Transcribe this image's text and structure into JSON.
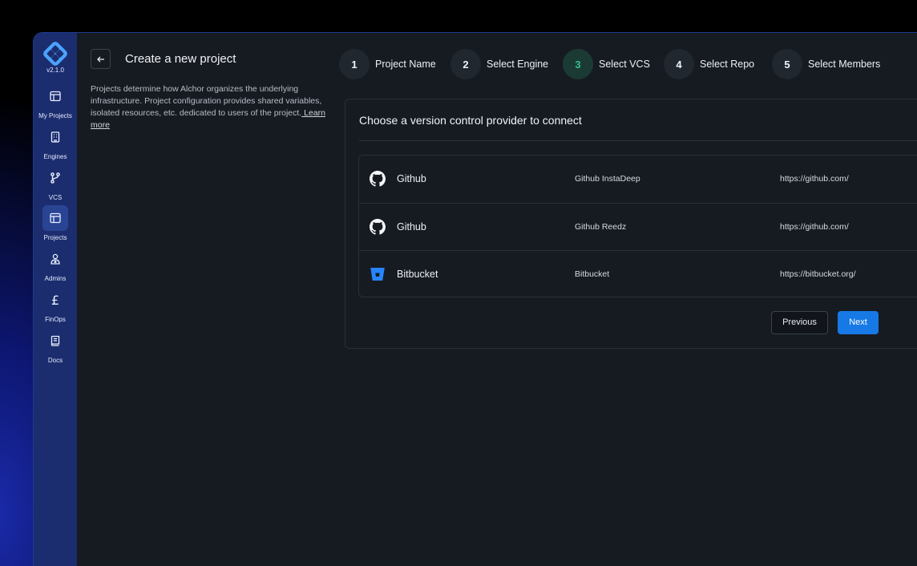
{
  "app": {
    "version": "v2.1.0"
  },
  "sidebar": {
    "items": [
      {
        "label": "My Projects",
        "icon": "layout-icon",
        "active": false
      },
      {
        "label": "Engines",
        "icon": "building-icon",
        "active": false
      },
      {
        "label": "VCS",
        "icon": "git-branch-icon",
        "active": false
      },
      {
        "label": "Projects",
        "icon": "layout-icon",
        "active": true
      },
      {
        "label": "Admins",
        "icon": "admin-user-icon",
        "active": false
      },
      {
        "label": "FinOps",
        "icon": "pound-icon",
        "active": false
      },
      {
        "label": "Docs",
        "icon": "book-icon",
        "active": false
      }
    ]
  },
  "header": {
    "title": "Create a new project",
    "description": "Projects determine how Alchor organizes the underlying infrastructure.  Project configuration provides shared variables, isolated resources,  etc. dedicated to users of the project.",
    "learn_more": " Learn more"
  },
  "steps": [
    {
      "number": "1",
      "label": "Project Name"
    },
    {
      "number": "2",
      "label": "Select Engine"
    },
    {
      "number": "3",
      "label": "Select VCS",
      "current": true
    },
    {
      "number": "4",
      "label": "Select Repo"
    },
    {
      "number": "5",
      "label": "Select Members"
    }
  ],
  "card": {
    "title": "Choose a version control provider to connect",
    "providers": [
      {
        "name": "Github",
        "account": "Github InstaDeep",
        "url": "https://github.com/",
        "icon": "github-icon"
      },
      {
        "name": "Github",
        "account": "Github Reedz",
        "url": "https://github.com/",
        "icon": "github-icon"
      },
      {
        "name": "Bitbucket",
        "account": "Bitbucket",
        "url": "https://bitbucket.org/",
        "icon": "bitbucket-icon"
      }
    ],
    "previous_label": "Previous",
    "next_label": "Next"
  },
  "colors": {
    "accent": "#1679e5",
    "current_step": "#33c18a",
    "sidebar": "#1b2d6e",
    "background": "#161b22",
    "bitbucket": "#2684ff"
  }
}
